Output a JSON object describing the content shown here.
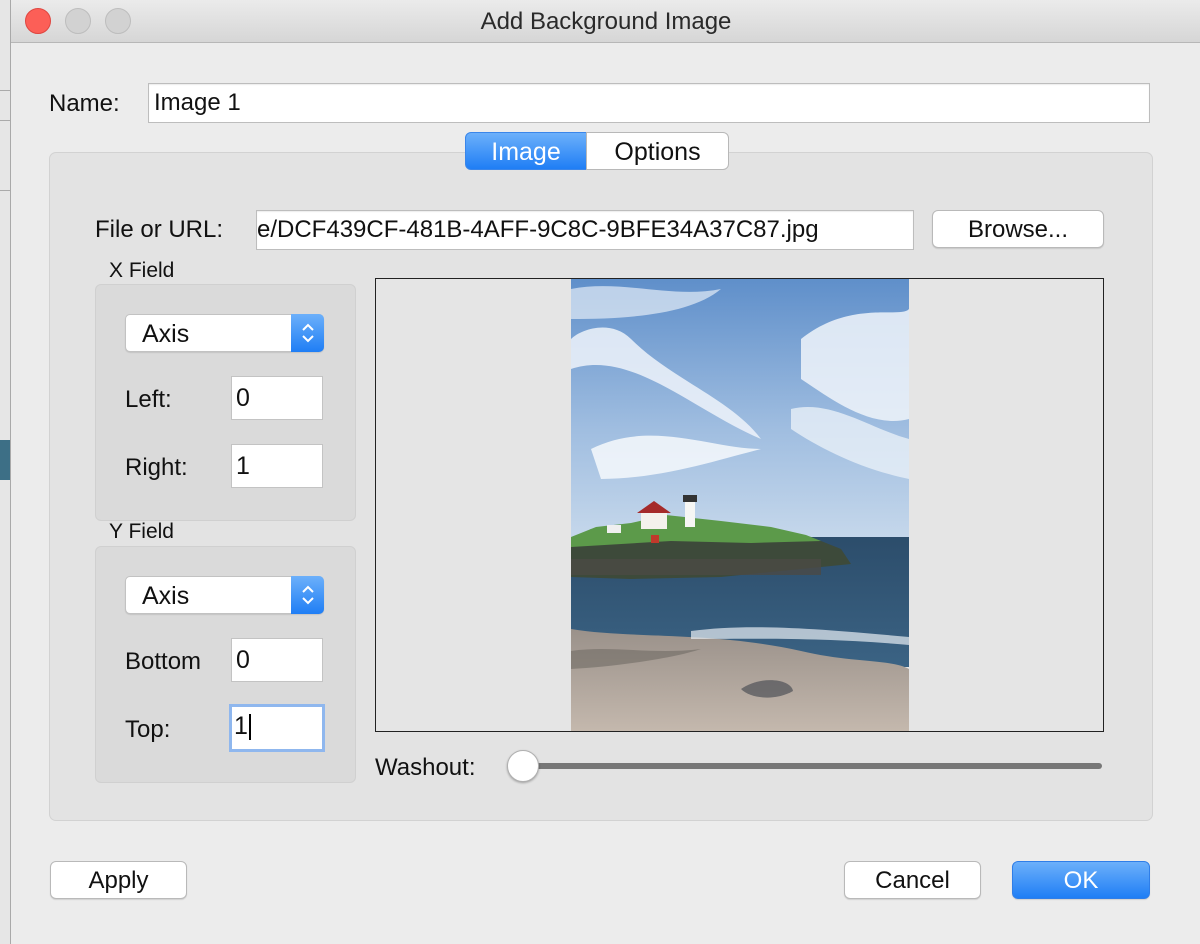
{
  "window": {
    "title": "Add Background Image"
  },
  "name_field": {
    "label": "Name:",
    "value": "Image 1"
  },
  "tabs": [
    {
      "label": "Image",
      "selected": true
    },
    {
      "label": "Options",
      "selected": false
    }
  ],
  "file": {
    "label": "File or URL:",
    "value": "e/DCF439CF-481B-4AFF-9C8C-9BFE34A37C87.jpg",
    "browse_label": "Browse..."
  },
  "x_field": {
    "group_label": "X Field",
    "mode": "Axis",
    "left_label": "Left:",
    "left_value": "0",
    "right_label": "Right:",
    "right_value": "1"
  },
  "y_field": {
    "group_label": "Y Field",
    "mode": "Axis",
    "bottom_label": "Bottom",
    "bottom_value": "0",
    "top_label": "Top:",
    "top_value": "1"
  },
  "washout": {
    "label": "Washout:",
    "value": 0
  },
  "buttons": {
    "apply": "Apply",
    "cancel": "Cancel",
    "ok": "OK"
  },
  "colors": {
    "accent": "#1f7ef5",
    "close": "#fc5f57"
  }
}
